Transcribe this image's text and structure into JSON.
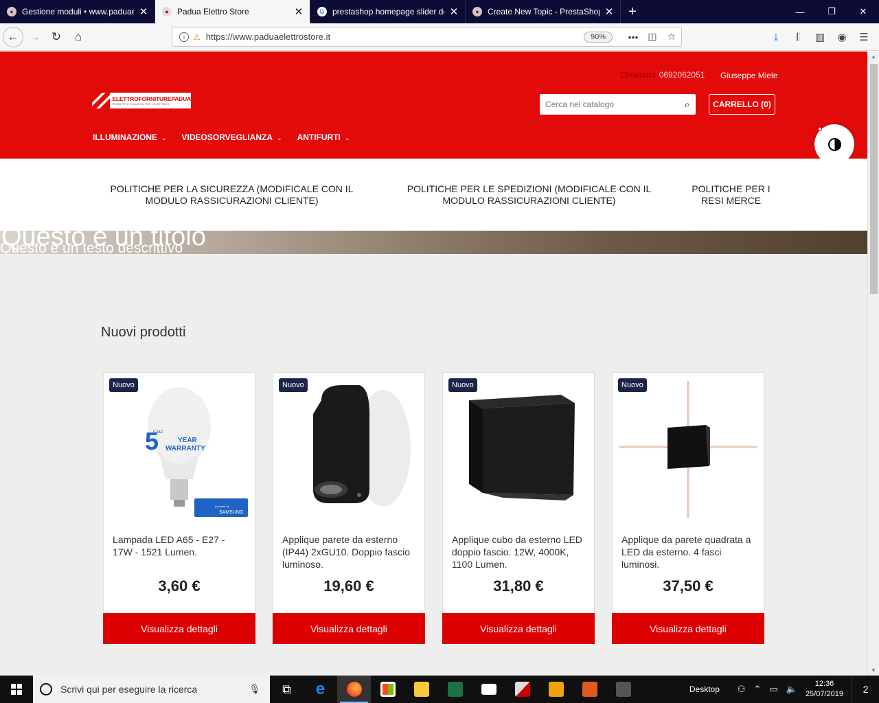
{
  "browser": {
    "tabs": [
      {
        "title": "Gestione moduli • www.paduaelettrostore.it"
      },
      {
        "title": "Padua Elettro Store"
      },
      {
        "title": "prestashop homepage slider dopo header"
      },
      {
        "title": "Create New Topic - PrestaShop"
      }
    ],
    "url": "https://www.paduaelettrostore.it",
    "zoom": "90%"
  },
  "site": {
    "call_label": "Chiamaci:",
    "phone": "0692062051",
    "user": "Giuseppe Miele",
    "logo_title": "ELETTROFORNITUREPADUA",
    "logo_subtitle": "PRODOTTI E SOLUZIONI PER L'ELETTRICO",
    "search_placeholder": "Cerca nel catalogo",
    "cart": "CARRELLO (0)",
    "menu": [
      "ILLUMINAZIONE",
      "VIDEOSORVEGLIANZA",
      "ANTIFURTI"
    ],
    "reassurance": [
      "POLITICHE PER LA SICUREZZA (MODIFICALE CON IL MODULO RASSICURAZIONI CLIENTE)",
      "POLITICHE PER LE SPEDIZIONI (MODIFICALE CON IL MODULO RASSICURAZIONI CLIENTE)",
      "POLITICHE PER I RESI MERCE"
    ],
    "slider": {
      "title": "Questo è un titolo",
      "text": "Questo è un testo descrittivo"
    },
    "section_title": "Nuovi prodotti",
    "products": [
      {
        "badge": "Nuovo",
        "name": "Lampada LED A65 - E27 - 17W - 1521 Lumen.",
        "price": "3,60 €",
        "button": "Visualizza dettagli"
      },
      {
        "badge": "Nuovo",
        "name": "Applique parete da esterno (IP44) 2xGU10. Doppio fascio luminoso.",
        "price": "19,60 €",
        "button": "Visualizza dettagli"
      },
      {
        "badge": "Nuovo",
        "name": "Applique cubo da esterno LED doppio fascio. 12W, 4000K, 1100 Lumen.",
        "price": "31,80 €",
        "button": "Visualizza dettagli"
      },
      {
        "badge": "Nuovo",
        "name": "Applique da parete quadrata a LED da esterno. 4 fasci luminosi.",
        "price": "37,50 €",
        "button": "Visualizza dettagli"
      }
    ],
    "bulb_label": {
      "brand": "V-TAC",
      "years": "5",
      "year_word": "YEAR",
      "warranty": "WARRANTY",
      "provided": "provided by",
      "maker": "SAMSUNG"
    }
  },
  "taskbar": {
    "search_placeholder": "Scrivi qui per eseguire la ricerca",
    "desktop_label": "Desktop",
    "time": "12:36",
    "date": "25/07/2019",
    "notifications": "2"
  },
  "colors": {
    "brand_red": "#e30a0a",
    "badge_navy": "#1c2548",
    "button_red": "#dd0000"
  }
}
